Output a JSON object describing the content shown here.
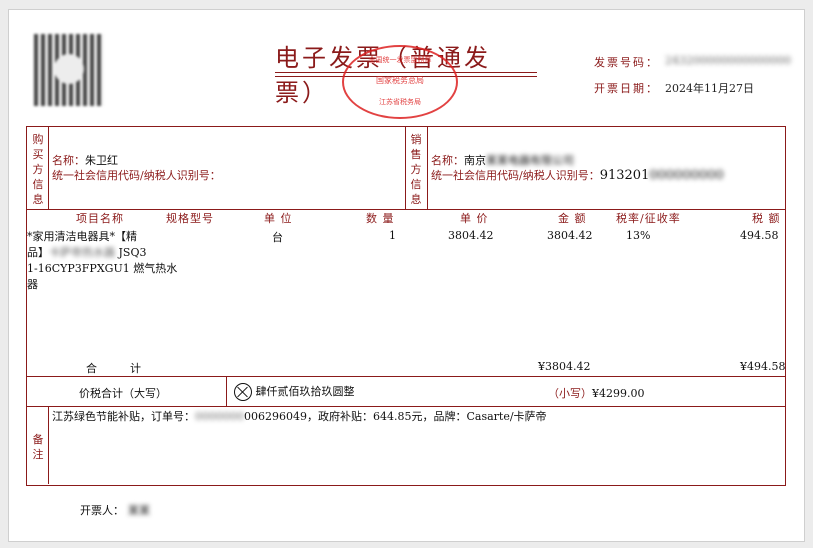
{
  "invoice": {
    "title": "电子发票（普通发票）",
    "number_label": "发票号码：",
    "number_value": "243200000000000000",
    "date_label": "开票日期：",
    "date_value": "2024年11月27日"
  },
  "seal": {
    "top": "全国统一发票监制章",
    "middle": "国家税务总局",
    "bottom": "江苏省税务局"
  },
  "buyer": {
    "section": "购买方信息",
    "name_label": "名称：",
    "name_value": "朱卫红",
    "taxid_label": "统一社会信用代码/纳税人识别号：",
    "taxid_value": ""
  },
  "seller": {
    "section": "销售方信息",
    "name_label": "名称：",
    "name_visible": "南京",
    "name_hidden": "某某电器有限公司",
    "taxid_label": "统一社会信用代码/纳税人识别号：",
    "taxid_visible": "913201",
    "taxid_hidden": "000000000"
  },
  "columns": {
    "item": "项目名称",
    "spec": "规格型号",
    "unit": "单 位",
    "qty": "数 量",
    "price": "单 价",
    "amount": "金 额",
    "rate": "税率/征收率",
    "tax": "税 额"
  },
  "item": {
    "name_line1": "*家用清洁电器具*【精",
    "name_line2_visible": "品】",
    "name_line2_hidden": "卡萨帝热水器",
    "name_line2_end": " JSQ3",
    "name_line3": "1-16CYP3FPXGU1 燃气热水",
    "name_line4": "器",
    "unit": "台",
    "qty": "1",
    "price": "3804.42",
    "amount": "3804.42",
    "rate": "13%",
    "tax": "494.58"
  },
  "totals": {
    "label": "合　　　计",
    "amount": "¥3804.42",
    "tax": "¥494.58",
    "grand_label": "价税合计（大写）",
    "grand_words": "肆仟贰佰玖拾玖圆整",
    "small_label": "（小写）",
    "small_value": "¥4299.00"
  },
  "remarks": {
    "label": "备注",
    "text_prefix": "江苏绿色节能补贴，订单号：",
    "order_hidden": "0000000",
    "text_suffix": "006296049，政府补贴：644.85元，品牌：Casarte/卡萨帝"
  },
  "issuer": {
    "label": "开票人：",
    "value_hidden": "某某"
  }
}
